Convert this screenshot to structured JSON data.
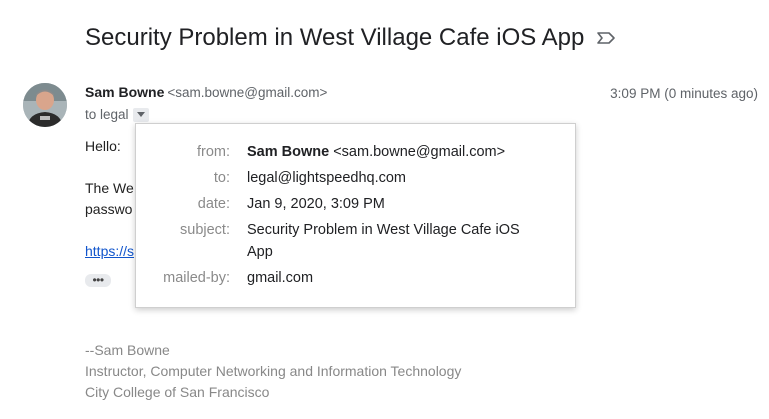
{
  "email": {
    "subject": "Security Problem in West Village Cafe iOS App",
    "sender_name": "Sam Bowne",
    "sender_email": "<sam.bowne@gmail.com>",
    "timestamp": "3:09 PM (0 minutes ago)",
    "to_label": "to legal",
    "body": {
      "greeting": "Hello:",
      "line1_visible": "The We",
      "line2_visible": "passwo",
      "link_visible": "https://s"
    },
    "signature": [
      "--Sam Bowne",
      "Instructor, Computer Networking and Information Technology",
      "City College of San Francisco"
    ]
  },
  "details_popup": {
    "rows": [
      {
        "label": "from:",
        "name": "Sam Bowne",
        "value": "<sam.bowne@gmail.com>"
      },
      {
        "label": "to:",
        "value": "legal@lightspeedhq.com"
      },
      {
        "label": "date:",
        "value": "Jan 9, 2020, 3:09 PM"
      },
      {
        "label": "subject:",
        "value": "Security Problem in West Village Cafe iOS App"
      },
      {
        "label": "mailed-by:",
        "value": "gmail.com"
      }
    ]
  },
  "icons": {
    "importance": "importance-marker-icon",
    "avatar": "avatar-photo",
    "dropdown": "chevron-down-icon",
    "ellipsis": "show-trimmed-content-icon"
  }
}
